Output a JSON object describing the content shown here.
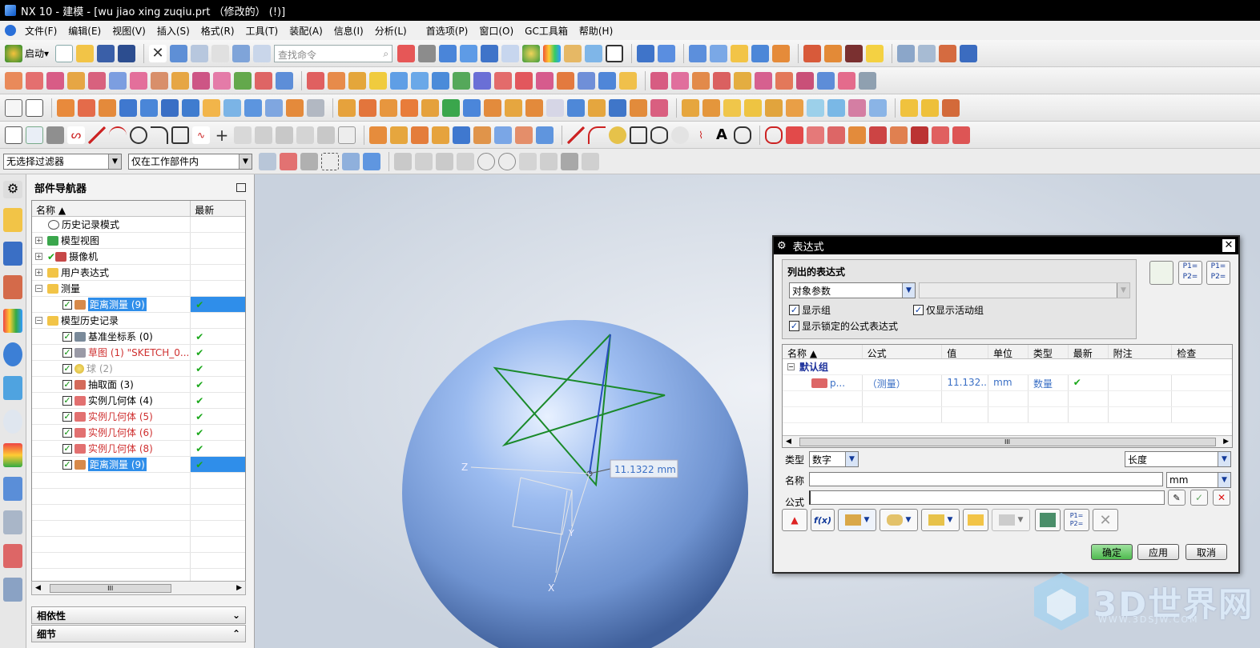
{
  "window": {
    "title": "NX 10 - 建模 - [wu jiao xing zuqiu.prt （修改的） (!)]"
  },
  "menu": [
    "文件(F)",
    "编辑(E)",
    "视图(V)",
    "插入(S)",
    "格式(R)",
    "工具(T)",
    "装配(A)",
    "信息(I)",
    "分析(L)",
    "首选项(P)",
    "窗口(O)",
    "GC工具箱",
    "帮助(H)"
  ],
  "toolbar": {
    "start_label": "启动",
    "search_placeholder": "查找命令"
  },
  "filters": {
    "selection_filter": "无选择过滤器",
    "scope": "仅在工作部件内"
  },
  "navigator": {
    "title": "部件导航器",
    "col_name": "名称",
    "col_latest": "最新",
    "rows": [
      {
        "label": "历史记录模式",
        "latest": "",
        "selected": false
      },
      {
        "label": "模型视图",
        "latest": "",
        "selected": false
      },
      {
        "label": "摄像机",
        "latest": "",
        "selected": false
      },
      {
        "label": "用户表达式",
        "latest": "",
        "selected": false
      },
      {
        "label": "测量",
        "latest": "",
        "selected": false
      },
      {
        "label": "距离测量 (9)",
        "latest": "✔",
        "selected": true
      },
      {
        "label": "模型历史记录",
        "latest": "",
        "selected": false
      },
      {
        "label": "基准坐标系 (0)",
        "latest": "✔",
        "selected": false
      },
      {
        "label": "草图 (1) \"SKETCH_0...",
        "latest": "✔",
        "selected": false
      },
      {
        "label": "球 (2)",
        "latest": "✔",
        "selected": false
      },
      {
        "label": "抽取面 (3)",
        "latest": "✔",
        "selected": false
      },
      {
        "label": "实例几何体 (4)",
        "latest": "✔",
        "selected": false
      },
      {
        "label": "实例几何体 (5)",
        "latest": "✔",
        "selected": false
      },
      {
        "label": "实例几何体 (6)",
        "latest": "✔",
        "selected": false
      },
      {
        "label": "实例几何体 (8)",
        "latest": "✔",
        "selected": false
      },
      {
        "label": "距离测量 (9)",
        "latest": "✔",
        "selected": true
      }
    ],
    "scroll_grip": "III",
    "dependency_label": "相依性",
    "details_label": "细节"
  },
  "viewport": {
    "measure_label": "11.1322 mm",
    "axis_z": "Z",
    "axis_x": "X",
    "axis_y": "Y"
  },
  "expressions_dialog": {
    "title": "表达式",
    "group_title": "列出的表达式",
    "list_filter": "对象参数",
    "show_groups": "显示组",
    "show_active_only": "仅显示活动组",
    "show_locked": "显示锁定的公式表达式",
    "columns": [
      "名称",
      "公式",
      "值",
      "单位",
      "类型",
      "最新",
      "附注",
      "检查"
    ],
    "group_row": "默认组",
    "row": {
      "name": "p...",
      "formula": "（测量）",
      "value": "11.132...",
      "unit": "mm",
      "type": "数量",
      "latest": "✔"
    },
    "scroll_grip": "III",
    "type_label": "类型",
    "type_value": "数字",
    "dimension_value": "长度",
    "name_label": "名称",
    "unit_value": "mm",
    "formula_label": "公式",
    "fx_label": "f(x)",
    "ok_label": "确定",
    "apply_label": "应用",
    "cancel_label": "取消"
  },
  "watermark": {
    "text": "3D世界网",
    "url": "WWW.3DSJW.COM"
  },
  "colors": {
    "selection": "#2f8eea",
    "sphere": "#8fb1e8",
    "sketch_curve": "#1a8a2a",
    "ok_button": "#5ec95e"
  }
}
